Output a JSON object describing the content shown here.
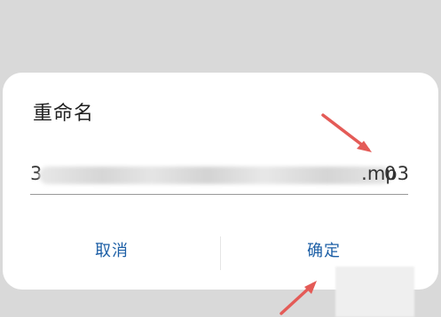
{
  "dialog": {
    "title": "重命名",
    "filename_prefix": "3",
    "filename_suffix": "0",
    "filename_extension": ".mp3",
    "cancel_label": "取消",
    "confirm_label": "确定"
  },
  "colors": {
    "background": "#d9d9d9",
    "dialog": "#ffffff",
    "button_text": "#1d5fa6",
    "annotation_arrow": "#e45b57"
  },
  "icons": {
    "annotation_arrow_1": "annotation-arrow-icon",
    "annotation_arrow_2": "annotation-arrow-icon"
  }
}
